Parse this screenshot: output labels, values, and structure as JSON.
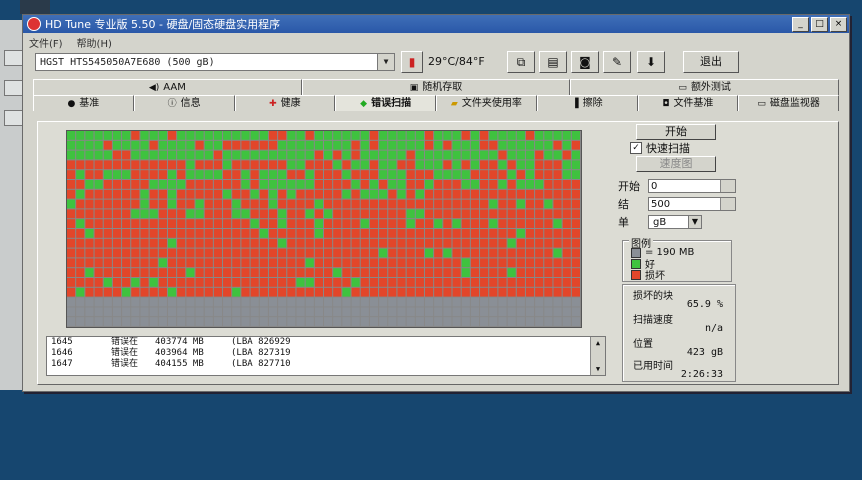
{
  "window": {
    "title": "HD Tune 专业版 5.50 - 硬盘/固态硬盘实用程序",
    "controls": [
      "_",
      "□",
      "×"
    ]
  },
  "menu": [
    "文件(F)",
    "帮助(H)"
  ],
  "toolbar": {
    "drive": "HGST HTS545050A7E680 (500 gB)",
    "temperature": "29°C/84°F",
    "exit_label": "退出"
  },
  "tabs_row1": [
    {
      "label": "AAM",
      "icon": "speaker-icon"
    },
    {
      "label": "随机存取",
      "icon": "dice-icon"
    },
    {
      "label": "额外测试",
      "icon": "monitor-icon"
    }
  ],
  "tabs_row2": [
    {
      "label": "基准",
      "icon": "bulb-icon"
    },
    {
      "label": "信息",
      "icon": "info-icon"
    },
    {
      "label": "健康",
      "icon": "cross-icon"
    },
    {
      "label": "错误扫描",
      "icon": "scan-icon"
    },
    {
      "label": "文件夹使用率",
      "icon": "folder-icon"
    },
    {
      "label": "擦除",
      "icon": "erase-icon"
    },
    {
      "label": "文件基准",
      "icon": "file-icon"
    },
    {
      "label": "磁盘监视器",
      "icon": "monitor-icon"
    }
  ],
  "active_tab": "错误扫描",
  "scan": {
    "start_button": "开始",
    "quick_scan_label": "快速扫描",
    "quick_scan_checked": true,
    "speed_map_button": "速度图",
    "start_label": "开始",
    "start_value": "0",
    "end_label": "结",
    "end_value": "500",
    "unit_label": "单",
    "unit_value": "gB"
  },
  "legend": {
    "title": "图例",
    "block_size": "= 190 MB",
    "ok_label": "好",
    "bad_label": "损坏",
    "colors": {
      "unscanned": "#8a8f96",
      "ok": "#3fc23f",
      "bad": "#e2462a"
    }
  },
  "stats": {
    "damaged_label": "损坏的块",
    "damaged_value": "65.9 %",
    "speed_label": "扫描速度",
    "speed_value": "n/a",
    "position_label": "位置",
    "position_value": "423 gB",
    "elapsed_label": "已用时间",
    "elapsed_value": "2:26:33"
  },
  "log": [
    {
      "n": "1645",
      "msg": "错误在",
      "mb": "403774 MB",
      "lba": "(LBA 826929"
    },
    {
      "n": "1646",
      "msg": "错误在",
      "mb": "403964 MB",
      "lba": "(LBA 827319"
    },
    {
      "n": "1647",
      "msg": "错误在",
      "mb": "404155 MB",
      "lba": "(LBA 827710"
    }
  ]
}
